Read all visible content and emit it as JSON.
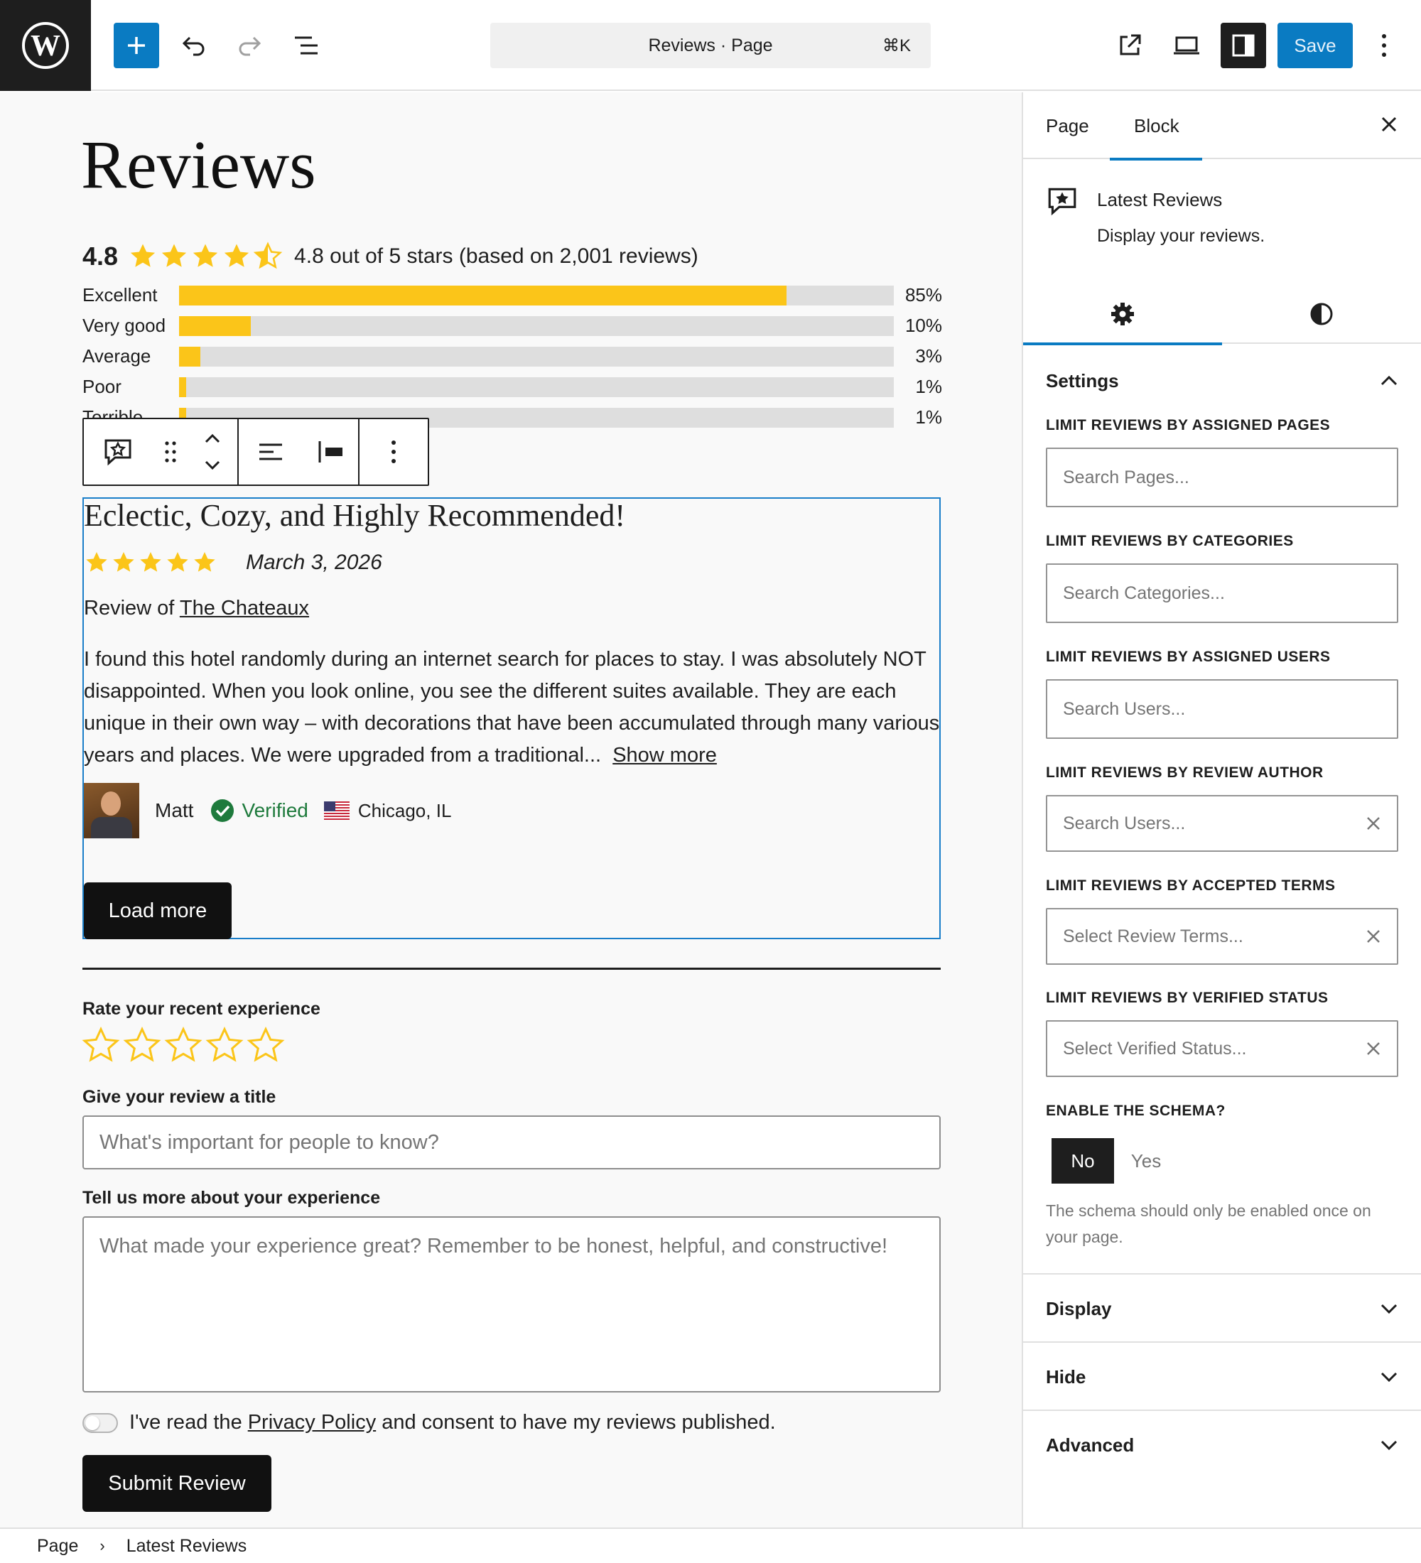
{
  "toolbar": {
    "command_title": "Reviews · Page",
    "command_shortcut": "⌘K",
    "save_label": "Save"
  },
  "page": {
    "title": "Reviews"
  },
  "rating_summary": {
    "average": "4.8",
    "stars": 4.5,
    "summary_text": "4.8 out of 5 stars (based on 2,001 reviews)",
    "breakdown": [
      {
        "label": "Excellent",
        "percent_text": "85%",
        "value": 85
      },
      {
        "label": "Very good",
        "percent_text": "10%",
        "value": 10
      },
      {
        "label": "Average",
        "percent_text": "3%",
        "value": 3
      },
      {
        "label": "Poor",
        "percent_text": "1%",
        "value": 1
      },
      {
        "label": "Terrible",
        "percent_text": "1%",
        "value": 1
      }
    ]
  },
  "review": {
    "title": "Eclectic, Cozy, and Highly Recommended!",
    "stars": 5,
    "date": "March 3, 2026",
    "review_of_prefix": "Review of",
    "review_of_link": "The Chateaux",
    "body": "I found this hotel randomly during an internet search for places to stay. I was absolutely NOT disappointed. When you look online, you see the different suites available. They are each unique in their own way – with decorations that have been accumulated through many various years and places. We were upgraded from a traditional...",
    "show_more": "Show more",
    "author": "Matt",
    "verified_label": "Verified",
    "location": "Chicago, IL"
  },
  "load_more_label": "Load more",
  "form": {
    "rate_label": "Rate your recent experience",
    "title_label": "Give your review a title",
    "title_placeholder": "What's important for people to know?",
    "body_label": "Tell us more about your experience",
    "body_placeholder": "What made your experience great? Remember to be honest, helpful, and constructive!",
    "consent_prefix": "I've read the",
    "consent_link": "Privacy Policy",
    "consent_suffix": "and consent to have my reviews published.",
    "submit_label": "Submit Review"
  },
  "sidebar": {
    "tabs": [
      "Page",
      "Block"
    ],
    "block_name": "Latest Reviews",
    "block_description": "Display your reviews.",
    "settings_title": "Settings",
    "fields": [
      {
        "label": "Limit reviews by assigned pages",
        "placeholder": "Search Pages..."
      },
      {
        "label": "Limit reviews by categories",
        "placeholder": "Search Categories..."
      },
      {
        "label": "Limit reviews by assigned users",
        "placeholder": "Search Users..."
      },
      {
        "label": "Limit reviews by review author",
        "placeholder": "Search Users..."
      },
      {
        "label": "Limit reviews by accepted terms",
        "placeholder": "Select Review Terms..."
      },
      {
        "label": "Limit reviews by verified status",
        "placeholder": "Select Verified Status..."
      }
    ],
    "schema_label": "Enable the schema?",
    "schema_no": "No",
    "schema_yes": "Yes",
    "schema_help": "The schema should only be enabled once on your page.",
    "panels": [
      "Display",
      "Hide",
      "Advanced"
    ]
  },
  "breadcrumb": [
    "Page",
    "Latest Reviews"
  ],
  "colors": {
    "accent": "#0a7bc2",
    "star": "#fbc519",
    "verified": "#1e7a3c"
  }
}
